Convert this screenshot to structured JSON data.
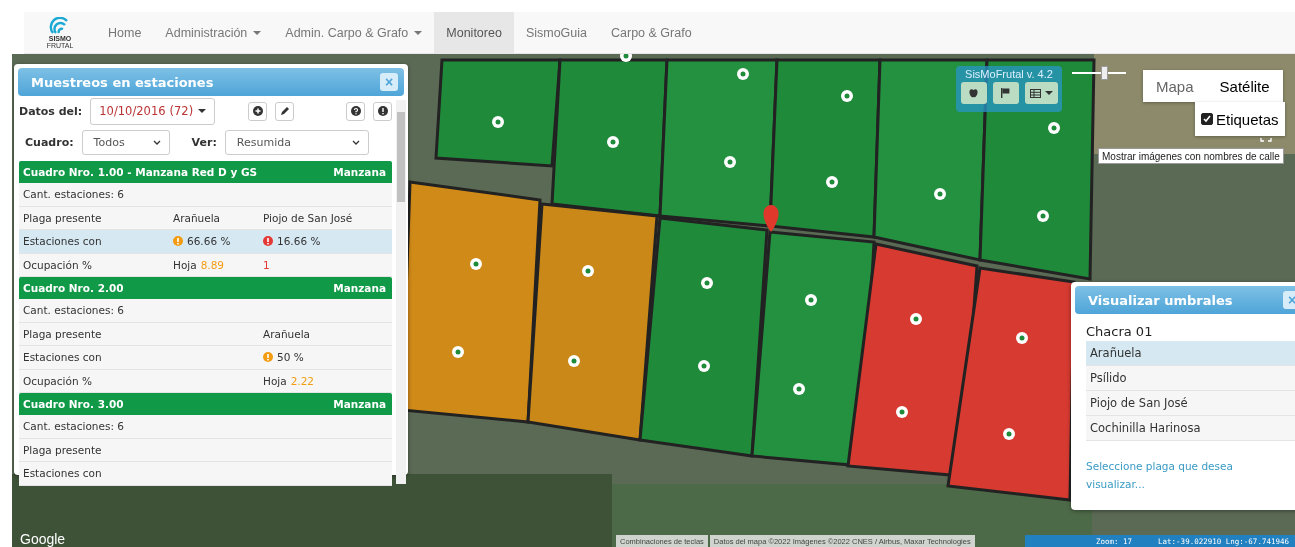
{
  "navbar": {
    "logo": {
      "line1": "SISMO",
      "line2": "FRUTAL"
    },
    "items": [
      {
        "label": "Home",
        "dropdown": false,
        "selected": false
      },
      {
        "label": "Administración",
        "dropdown": true,
        "selected": false
      },
      {
        "label": "Admin. Carpo & Grafo",
        "dropdown": true,
        "selected": false
      },
      {
        "label": "Monitoreo",
        "dropdown": false,
        "selected": true
      },
      {
        "label": "SismoGuia",
        "dropdown": false,
        "selected": false
      },
      {
        "label": "Carpo & Grafo",
        "dropdown": false,
        "selected": false
      }
    ]
  },
  "stations_panel": {
    "title": "Muestreos en estaciones",
    "close": "×",
    "date_label": "Datos del:",
    "date": "10/10/2016",
    "count": "(72)",
    "cuadro_label": "Cuadro:",
    "cuadro_value": "Todos",
    "ver_label": "Ver:",
    "ver_value": "Resumida",
    "groups": [
      {
        "title": "Cuadro Nro. 1.00 - Manzana Red D y GS",
        "fruit": "Manzana",
        "rows": [
          {
            "kind": "count",
            "label": "Cant. estaciones: 6",
            "selected": false
          },
          {
            "kind": "pest",
            "label": "Plaga presente",
            "cells": [
              {
                "text": "Arañuela"
              },
              {
                "text": "Piojo de San José"
              }
            ],
            "selected": false
          },
          {
            "kind": "alert",
            "label": "Estaciones con",
            "cells": [
              {
                "text": "66.66 %",
                "color": "#f39c12"
              },
              {
                "text": "16.66 %",
                "color": "#e53935"
              }
            ],
            "selected": true
          },
          {
            "kind": "occupancy",
            "label": "Ocupación %",
            "cells": [
              {
                "text": "Hoja",
                "value": "8.89",
                "color": "#f39c12"
              },
              {
                "value": "1",
                "color": "#e53935"
              }
            ],
            "selected": false
          }
        ]
      },
      {
        "title": "Cuadro Nro. 2.00",
        "fruit": "Manzana",
        "rows": [
          {
            "kind": "count",
            "label": "Cant. estaciones: 6",
            "selected": false
          },
          {
            "kind": "pest",
            "label": "Plaga presente",
            "cells": [
              null,
              {
                "text": "Arañuela"
              }
            ],
            "selected": false
          },
          {
            "kind": "alert",
            "label": "Estaciones con",
            "cells": [
              null,
              {
                "text": "50 %",
                "color": "#f39c12"
              }
            ],
            "selected": false
          },
          {
            "kind": "occupancy",
            "label": "Ocupación %",
            "cells": [
              null,
              {
                "text": "Hoja",
                "value": "2.22",
                "color": "#f39c12"
              }
            ],
            "selected": false
          }
        ]
      },
      {
        "title": "Cuadro Nro. 3.00",
        "fruit": "Manzana",
        "rows": [
          {
            "kind": "count",
            "label": "Cant. estaciones: 6",
            "selected": false
          },
          {
            "kind": "pest",
            "label": "Plaga presente",
            "cells": [],
            "selected": false
          },
          {
            "kind": "alert",
            "label": "Estaciones con",
            "cells": [],
            "selected": false
          }
        ]
      }
    ]
  },
  "map_toolbar": {
    "title": "SisMoFrutal v. 4.2",
    "buttons": [
      {
        "kind": "apple"
      },
      {
        "kind": "flag"
      },
      {
        "kind": "table"
      }
    ]
  },
  "opacity_slider": {
    "level": 0.6
  },
  "map_type": {
    "options": [
      {
        "label": "Mapa",
        "selected": false
      },
      {
        "label": "Satélite",
        "selected": true
      }
    ],
    "labels_option": {
      "label": "Etiquetas",
      "checked": true
    },
    "tooltip": "Mostrar imágenes con nombres de calle"
  },
  "thresholds_panel": {
    "title": "Visualizar umbrales",
    "close": "×",
    "subtitle": "Chacra 01",
    "items": [
      {
        "label": "Arañuela",
        "selected": true
      },
      {
        "label": "Psílido",
        "selected": false
      },
      {
        "label": "Piojo de San José",
        "selected": false
      },
      {
        "label": "Cochinilla Harinosa",
        "selected": false
      }
    ],
    "hint": "Seleccione plaga que desea visualizar..."
  },
  "map_footer": {
    "brand": "Google",
    "shortcuts": "Combinaciones de teclas",
    "attribution": "Datos del mapa ©2022 Imágenes ©2022 CNES / Airbus, Maxar Technologies",
    "zoom": "Zoom: 17",
    "coords": "Lat:-39.022910 Lng:-67.741946"
  }
}
